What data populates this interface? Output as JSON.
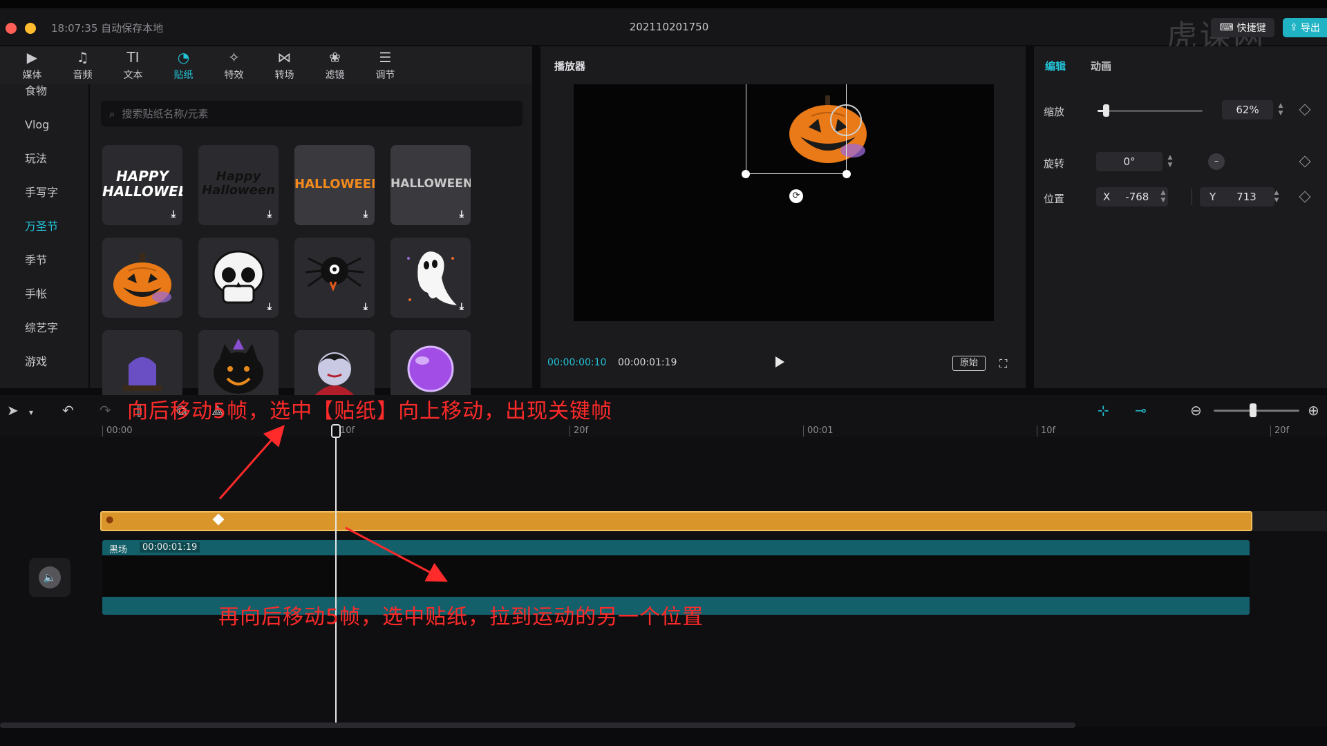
{
  "titlebar": {
    "autosave": "18:07:35 自动保存本地",
    "project_name": "202110201750",
    "quick_label": "快捷键",
    "export_label": "导出",
    "watermark": "虎课网"
  },
  "toolbar": {
    "items": [
      {
        "label": "媒体",
        "icon": "media-icon",
        "glyph": "▶"
      },
      {
        "label": "音频",
        "icon": "audio-icon",
        "glyph": "♫"
      },
      {
        "label": "文本",
        "icon": "text-icon",
        "glyph": "TI"
      },
      {
        "label": "贴纸",
        "icon": "sticker-icon",
        "glyph": "◔"
      },
      {
        "label": "特效",
        "icon": "effects-icon",
        "glyph": "✧"
      },
      {
        "label": "转场",
        "icon": "transition-icon",
        "glyph": "⋈"
      },
      {
        "label": "滤镜",
        "icon": "filter-icon",
        "glyph": "❀"
      },
      {
        "label": "调节",
        "icon": "adjust-icon",
        "glyph": "☰"
      }
    ],
    "active_index": 3
  },
  "categories": [
    "食物",
    "Vlog",
    "玩法",
    "手写字",
    "万圣节",
    "季节",
    "手帐",
    "综艺字",
    "游戏"
  ],
  "active_category": "万圣节",
  "sticker_search": {
    "placeholder": "搜索贴纸名称/元素"
  },
  "sticker_tiles": {
    "row1": [
      "HAPPY HALLOWEEN",
      "Happy Halloween",
      "HALLOWEEN",
      "HALLOWEEN"
    ],
    "row2": [
      "pumpkin",
      "skull",
      "spider",
      "ghost"
    ],
    "row3": [
      "tombstone",
      "black-cat",
      "vampire",
      "crystal-ball"
    ]
  },
  "player": {
    "title": "播放器",
    "current_time": "00:00:00:10",
    "total_time": "00:00:01:19",
    "ratio_label": "原始"
  },
  "properties": {
    "tab_edit": "编辑",
    "tab_animation": "动画",
    "scale_label": "缩放",
    "scale_value": "62%",
    "scale_fraction": 0.08,
    "rotate_label": "旋转",
    "rotate_value": "0°",
    "position_label": "位置",
    "x_label": "X",
    "x_value": "-768",
    "y_label": "Y",
    "y_value": "713"
  },
  "timeline": {
    "ruler": [
      "00:00",
      "10f",
      "20f",
      "00:01",
      "10f",
      "20f"
    ],
    "video_clip_name": "黑场",
    "video_clip_duration": "00:00:01:19"
  },
  "annotations": {
    "top": "向后移动5帧，选中【贴纸】向上移动，出现关键帧",
    "bottom": "再向后移动5帧，选中贴纸，拉到运动的另一个位置"
  },
  "colors": {
    "accent": "#22c3d6",
    "sticker_track": "#d9952a",
    "annotation": "#ff2a2a"
  }
}
